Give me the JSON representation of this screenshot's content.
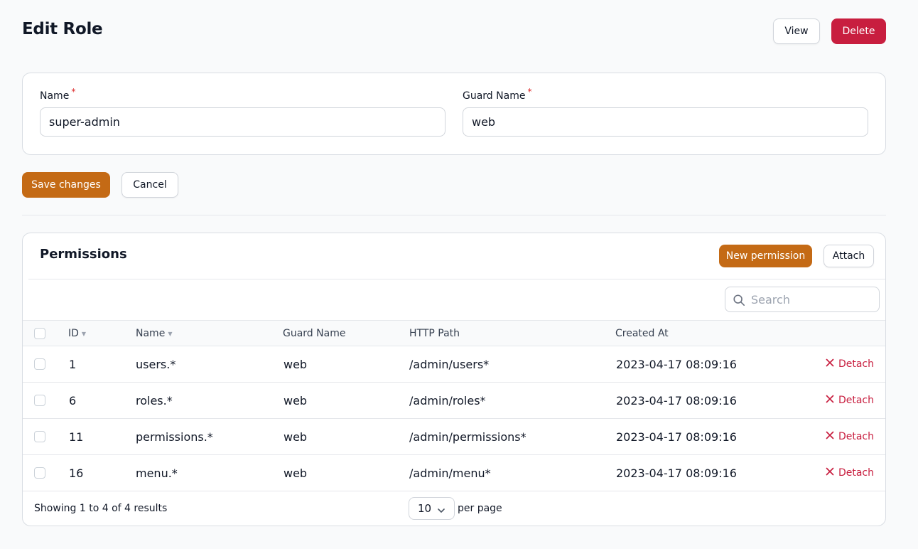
{
  "header": {
    "title": "Edit Role",
    "view_label": "View",
    "delete_label": "Delete"
  },
  "form": {
    "name_label": "Name",
    "name_value": "super-admin",
    "guard_label": "Guard Name",
    "guard_value": "web",
    "required_mark": "*",
    "save_label": "Save changes",
    "cancel_label": "Cancel"
  },
  "permissions": {
    "title": "Permissions",
    "new_label": "New permission",
    "attach_label": "Attach",
    "search_placeholder": "Search",
    "columns": {
      "id": "ID",
      "name": "Name",
      "guard": "Guard Name",
      "path": "HTTP Path",
      "created": "Created At"
    },
    "rows": [
      {
        "id": "1",
        "name": "users.*",
        "guard": "web",
        "path": "/admin/users*",
        "created": "2023-04-17 08:09:16",
        "action": "Detach"
      },
      {
        "id": "6",
        "name": "roles.*",
        "guard": "web",
        "path": "/admin/roles*",
        "created": "2023-04-17 08:09:16",
        "action": "Detach"
      },
      {
        "id": "11",
        "name": "permissions.*",
        "guard": "web",
        "path": "/admin/permissions*",
        "created": "2023-04-17 08:09:16",
        "action": "Detach"
      },
      {
        "id": "16",
        "name": "menu.*",
        "guard": "web",
        "path": "/admin/menu*",
        "created": "2023-04-17 08:09:16",
        "action": "Detach"
      }
    ],
    "footer": {
      "showing": "Showing 1 to 4 of 4 results",
      "per_page_value": "10",
      "per_page_label": "per page"
    }
  },
  "colors": {
    "primary": "#c46a15",
    "danger": "#c81e3f"
  }
}
